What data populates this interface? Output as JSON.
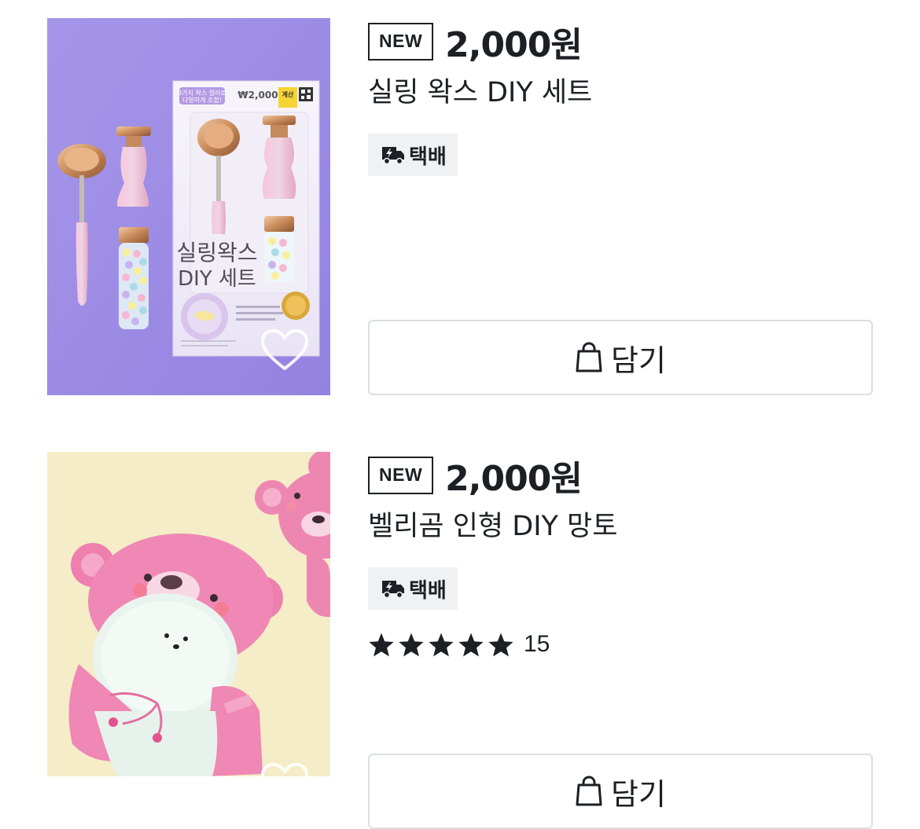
{
  "products": [
    {
      "badge": "NEW",
      "price": "2,000원",
      "title": "실링 왁스 DIY 세트",
      "delivery": "택배",
      "cart_label": "담기",
      "image": {
        "description_icon": "wax-seal-kit-photo",
        "box_text_main": "실링왁스",
        "box_text_sub": "DIY 세트",
        "box_price": "₩2,000",
        "box_tag": "3가지 왁스 컬러로",
        "box_tag2": "다양하게 조합!",
        "box_badge": "계산"
      }
    },
    {
      "badge": "NEW",
      "price": "2,000원",
      "title": "벨리곰 인형 DIY 망토",
      "delivery": "택배",
      "rating": {
        "stars": 5,
        "count": "15"
      },
      "image": {
        "description_icon": "bear-plush-cape-photo"
      }
    }
  ],
  "colors": {
    "text": "#1d1f24",
    "badge_bg": "#f0f1f3",
    "button_border": "#dcdee2",
    "photo1_bg": "#9e8ee6",
    "photo2_bg": "#f4edc8",
    "plush_pink": "#ee86b2"
  }
}
